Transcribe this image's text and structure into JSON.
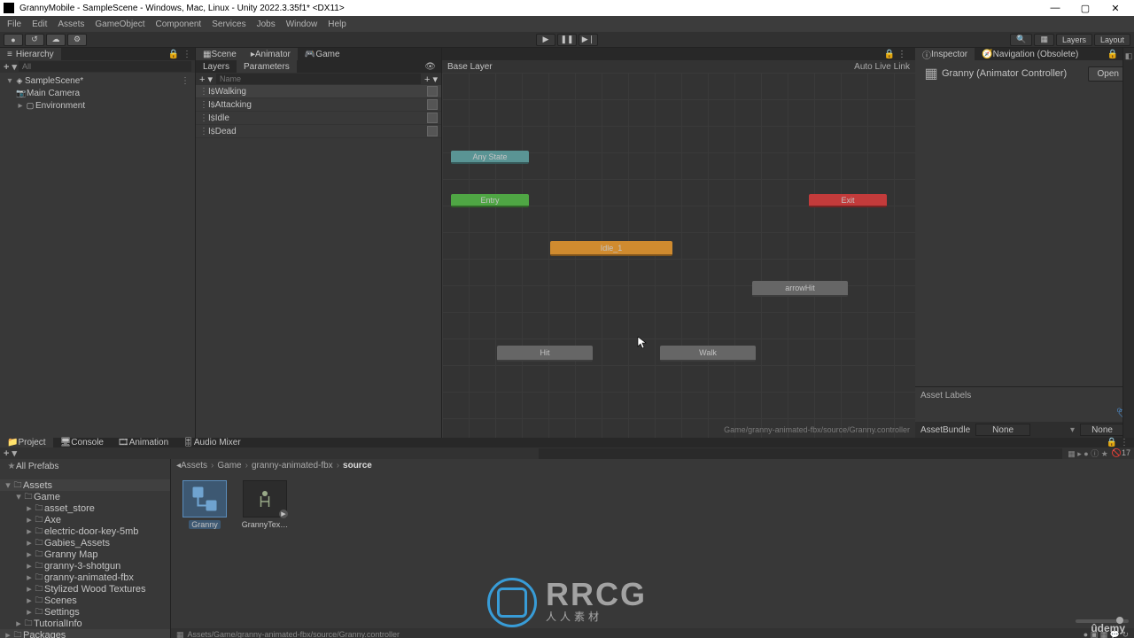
{
  "window": {
    "title": "GrannyMobile - SampleScene - Windows, Mac, Linux - Unity 2022.3.35f1* <DX11>"
  },
  "win_buttons": {
    "min": "—",
    "max": "▢",
    "close": "✕"
  },
  "menu": [
    "File",
    "Edit",
    "Assets",
    "GameObject",
    "Component",
    "Services",
    "Jobs",
    "Window",
    "Help"
  ],
  "topbar_left": [
    "●",
    "↺",
    "☁",
    "⚙"
  ],
  "play": [
    "▶",
    "❚❚",
    "▶❘"
  ],
  "topbar_right": {
    "search": "🔍",
    "grid": "▦",
    "layers": "Layers",
    "layout": "Layout"
  },
  "hierarchy": {
    "tab": "Hierarchy",
    "search_placeholder": "All",
    "scene": "SampleScene*",
    "items": [
      "Main Camera",
      "Environment"
    ]
  },
  "center_tabs": [
    "Scene",
    "Animator",
    "Game"
  ],
  "params_tabs": {
    "layers": "Layers",
    "params": "Parameters"
  },
  "param_search_placeholder": "Name",
  "params": [
    "IsWalking",
    "IsAttacking",
    "IsIdle",
    "IsDead"
  ],
  "animator": {
    "baselayer": "Base Layer",
    "autolink": "Auto Live Link",
    "path": "Game/granny-animated-fbx/source/Granny.controller",
    "nodes": {
      "anystate": "Any State",
      "entry": "Entry",
      "exit": "Exit",
      "idle": "Idle_1",
      "hit": "Hit",
      "walk": "Walk",
      "arrowhit": "arrowHit"
    }
  },
  "inspector": {
    "tabs": [
      "Inspector",
      "Navigation (Obsolete)"
    ],
    "asset_name": "Granny (Animator Controller)",
    "open": "Open",
    "asset_labels": "Asset Labels",
    "assetbundle": "AssetBundle",
    "none": "None"
  },
  "bottom": {
    "tabs": [
      "Project",
      "Console",
      "Animation",
      "Audio Mixer"
    ],
    "search_placeholder": "",
    "favorites": "All Prefabs",
    "tree": [
      {
        "l": 0,
        "t": "Assets",
        "fold": "▾",
        "bold": true
      },
      {
        "l": 1,
        "t": "Game",
        "fold": "▾"
      },
      {
        "l": 2,
        "t": "asset_store",
        "fold": "▸"
      },
      {
        "l": 2,
        "t": "Axe",
        "fold": "▸"
      },
      {
        "l": 2,
        "t": "electric-door-key-5mb",
        "fold": "▸"
      },
      {
        "l": 2,
        "t": "Gabies_Assets",
        "fold": "▸"
      },
      {
        "l": 2,
        "t": "Granny Map",
        "fold": "▸"
      },
      {
        "l": 2,
        "t": "granny-3-shotgun",
        "fold": "▸"
      },
      {
        "l": 2,
        "t": "granny-animated-fbx",
        "fold": "▸"
      },
      {
        "l": 2,
        "t": "Stylized Wood Textures",
        "fold": "▸"
      },
      {
        "l": 2,
        "t": "Scenes",
        "fold": "▸"
      },
      {
        "l": 2,
        "t": "Settings",
        "fold": "▸"
      },
      {
        "l": 1,
        "t": "TutorialInfo",
        "fold": "▸"
      },
      {
        "l": 0,
        "t": "Packages",
        "fold": "▸",
        "bold": true
      }
    ],
    "breadcrumb": [
      "Assets",
      "Game",
      "granny-animated-fbx",
      "source"
    ],
    "tiles": [
      {
        "name": "Granny",
        "sel": true
      },
      {
        "name": "GrannyTex…",
        "sel": false
      }
    ],
    "slider_label": "17",
    "status": "Assets/Game/granny-animated-fbx/source/Granny.controller"
  },
  "udemy": "ûdemy",
  "watermark": {
    "text": "RRCG",
    "sub": "人人素材"
  }
}
